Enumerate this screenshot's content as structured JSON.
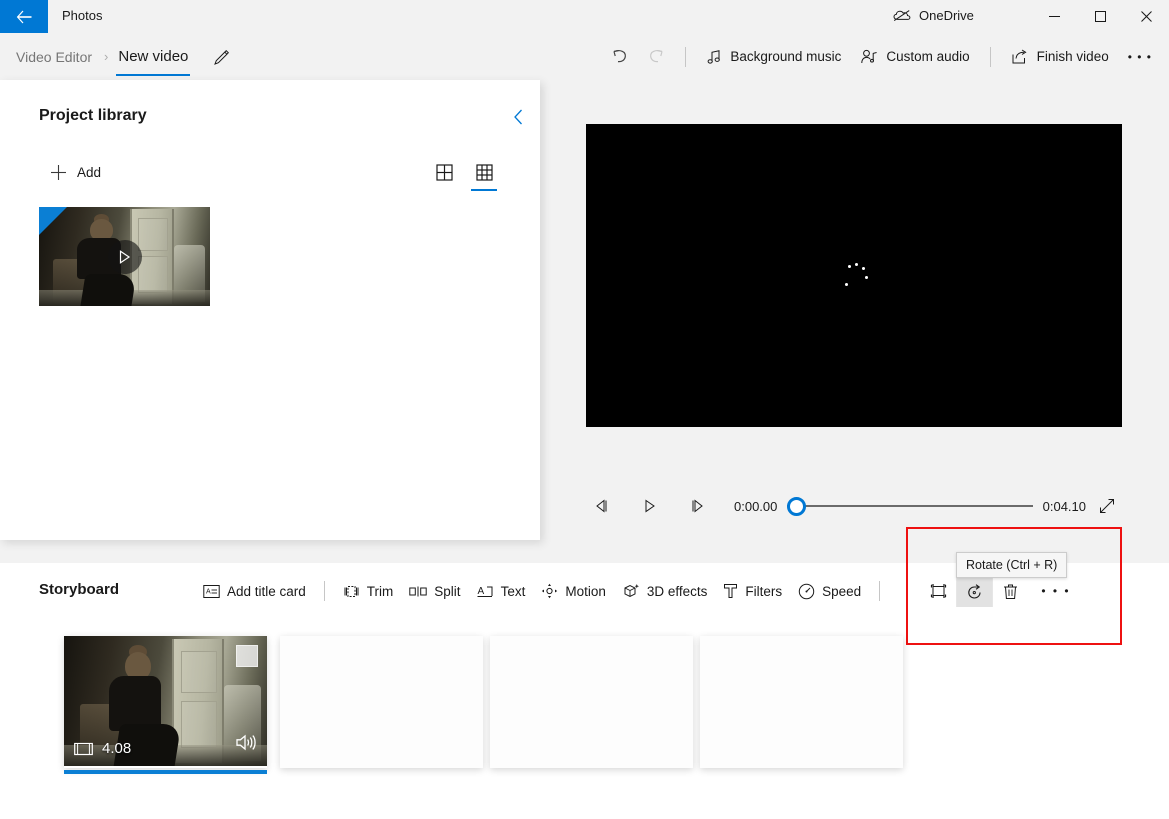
{
  "titlebar": {
    "back_icon": "back-arrow-icon",
    "app_name": "Photos",
    "onedrive_label": "OneDrive",
    "onedrive_icon": "onedrive-cloud-icon",
    "minimize": "─",
    "maximize": "□",
    "close": "✕"
  },
  "breadcrumb": {
    "root": "Video Editor",
    "separator": "›",
    "current": "New video",
    "rename_icon": "pencil-icon"
  },
  "commandbar": {
    "undo_icon": "undo-icon",
    "redo_icon": "redo-icon",
    "background_music": "Background music",
    "custom_audio": "Custom audio",
    "finish_video": "Finish video",
    "more": "• • •"
  },
  "library": {
    "title": "Project library",
    "collapse_icon": "chevron-left-icon",
    "add_label": "Add",
    "view_grid_large": "grid-2x2-icon",
    "view_grid_small": "grid-3x3-icon",
    "selected_view": "grid-3x3-icon",
    "item": {
      "selected": true,
      "play_icon": "play-icon"
    }
  },
  "preview": {
    "state": "loading",
    "spinner": "loading-dots-spinner",
    "prev_frame_icon": "previous-frame-icon",
    "play_icon": "play-icon",
    "next_frame_icon": "next-frame-icon",
    "current_time": "0:00.00",
    "total_time": "0:04.10",
    "progress_percent": 0,
    "expand_icon": "fullscreen-icon"
  },
  "storyboard": {
    "title": "Storyboard",
    "tools": [
      {
        "label": "Add title card",
        "icon": "title-card-icon"
      },
      {
        "label": "Trim",
        "icon": "trim-icon"
      },
      {
        "label": "Split",
        "icon": "split-icon"
      },
      {
        "label": "Text",
        "icon": "text-icon"
      },
      {
        "label": "Motion",
        "icon": "motion-icon"
      },
      {
        "label": "3D effects",
        "icon": "3d-effects-icon"
      },
      {
        "label": "Filters",
        "icon": "filters-icon"
      },
      {
        "label": "Speed",
        "icon": "speed-icon"
      }
    ],
    "mini_tools": [
      {
        "name": "crop-button",
        "icon": "crop-icon"
      },
      {
        "name": "rotate-button",
        "icon": "rotate-icon",
        "hovered": true
      },
      {
        "name": "delete-button",
        "icon": "trash-icon"
      },
      {
        "name": "more-button",
        "icon": "ellipsis-icon",
        "label": "• • •"
      }
    ],
    "tooltip": "Rotate (Ctrl + R)",
    "clips": [
      {
        "type": "video",
        "duration": "4.08",
        "duration_icon": "film-strip-icon",
        "audio_icon": "speaker-icon",
        "selected": true
      },
      {
        "type": "empty"
      },
      {
        "type": "empty"
      },
      {
        "type": "empty"
      }
    ]
  },
  "colors": {
    "accent": "#0078d4",
    "highlight_box": "#ee1111",
    "window_bg": "#f2f2f2",
    "panel_bg": "#ffffff"
  }
}
